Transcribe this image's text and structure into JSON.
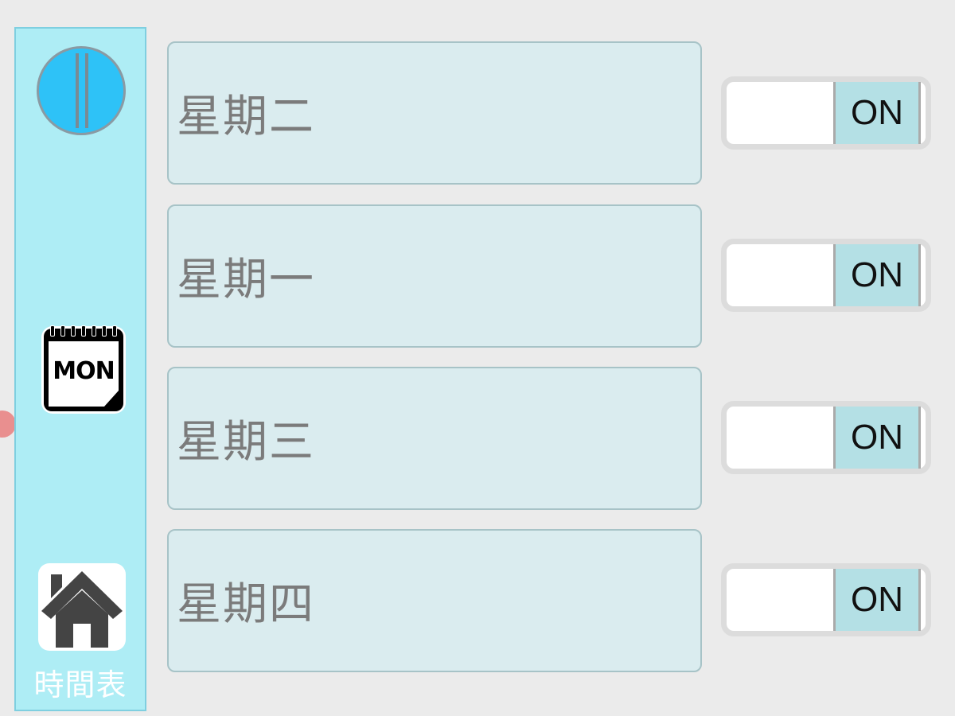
{
  "sidebar": {
    "title": "時間表",
    "calendar_text": "MON",
    "accent_color": "#aeedf5",
    "icons": [
      "round-toggle-icon",
      "calendar-mon-icon",
      "home-icon"
    ]
  },
  "days": [
    {
      "label": "星期二",
      "switch_text": "ON"
    },
    {
      "label": "星期一",
      "switch_text": "ON"
    },
    {
      "label": "星期三",
      "switch_text": "ON"
    },
    {
      "label": "星期四",
      "switch_text": "ON"
    }
  ]
}
